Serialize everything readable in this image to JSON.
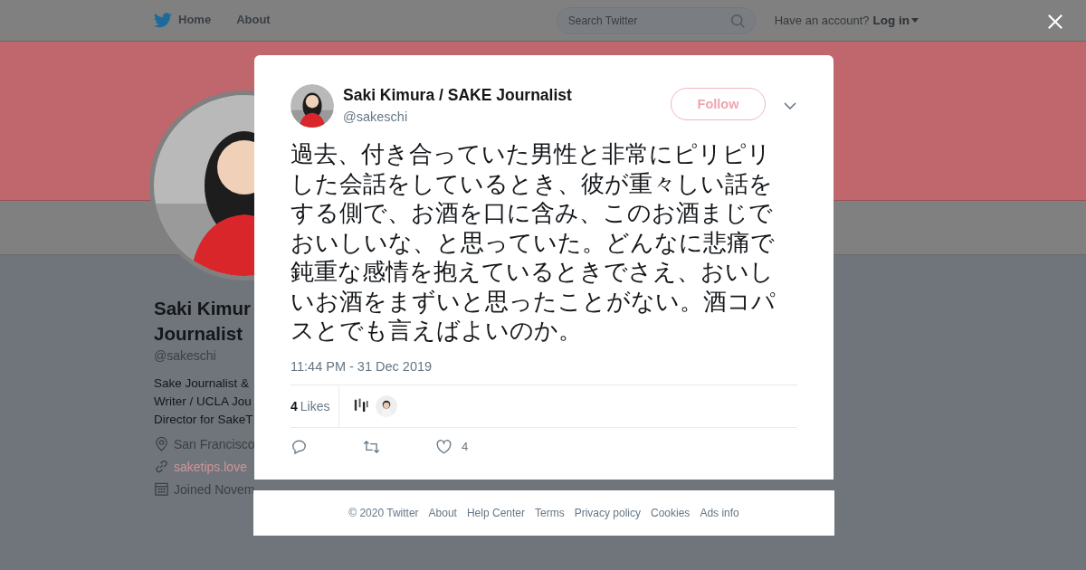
{
  "top_nav": {
    "links": [
      {
        "label": "Home"
      },
      {
        "label": "About"
      }
    ],
    "search": {
      "placeholder": "Search Twitter"
    },
    "account_prompt": "Have an account?",
    "login": "Log in"
  },
  "profile": {
    "name_lines": [
      "Saki Kimur",
      "Journalist"
    ],
    "handle": "@sakeschi",
    "bio_lines": [
      "Sake Journalist &",
      "Writer / UCLA Jou",
      "Director for SakeT"
    ],
    "location": "San Francisco",
    "website": "saketips.love",
    "joined": "Joined Novem"
  },
  "tweet": {
    "author": "Saki Kimura / SAKE Journalist",
    "handle": "@sakeschi",
    "follow": "Follow",
    "text": "過去、付き合っていた男性と非常にピリピリした会話をしているとき、彼が重々しい話をする側で、お酒を口に含み、このお酒まじでおいしいな、と思っていた。どんなに悲痛で鈍重な感情を抱えているときでさえ、おいしいお酒をまずいと思ったことがない。酒コパスとでも言えばよいのか。",
    "timestamp": "11:44 PM - 31 Dec 2019",
    "likes_count": "4",
    "likes_label": "Likes",
    "like_action_count": "4"
  },
  "footer": [
    "© 2020 Twitter",
    "About",
    "Help Center",
    "Terms",
    "Privacy policy",
    "Cookies",
    "Ads info"
  ]
}
